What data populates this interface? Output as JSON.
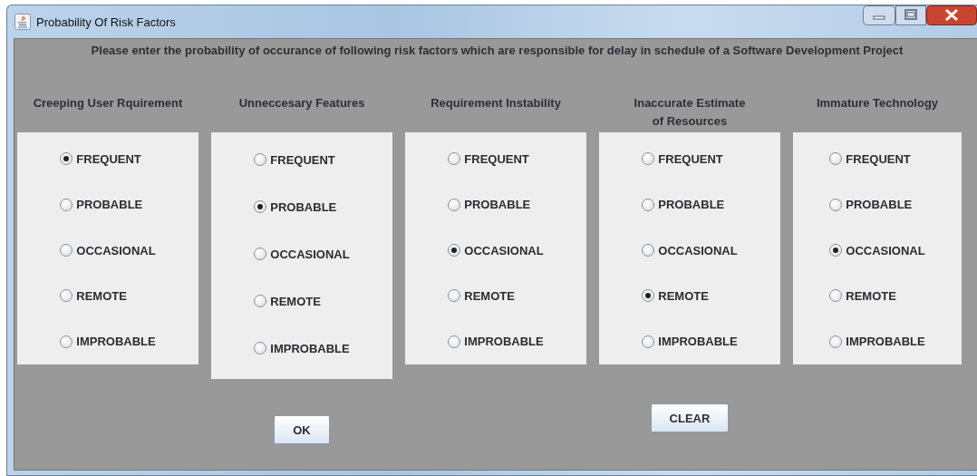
{
  "window": {
    "title": "Probability Of Risk Factors"
  },
  "instructions": "Please enter the probability of occurance of following risk factors which are responsible for delay in schedule of a Software Development Project",
  "risk_factors": [
    {
      "name": "Creeping User Rquirement",
      "options": [
        {
          "label": "FREQUENT",
          "selected": true
        },
        {
          "label": "PROBABLE",
          "selected": false
        },
        {
          "label": "OCCASIONAL",
          "selected": false
        },
        {
          "label": "REMOTE",
          "selected": false
        },
        {
          "label": "IMPROBABLE",
          "selected": false
        }
      ]
    },
    {
      "name": "Unneccesary Features",
      "options": [
        {
          "label": "FREQUENT",
          "selected": false
        },
        {
          "label": "PROBABLE",
          "selected": true
        },
        {
          "label": "OCCASIONAL",
          "selected": false
        },
        {
          "label": "REMOTE",
          "selected": false
        },
        {
          "label": "IMPROBABLE",
          "selected": false
        }
      ]
    },
    {
      "name": "Requirement Instability",
      "options": [
        {
          "label": "FREQUENT",
          "selected": false
        },
        {
          "label": "PROBABLE",
          "selected": false
        },
        {
          "label": "OCCASIONAL",
          "selected": true
        },
        {
          "label": "REMOTE",
          "selected": false
        },
        {
          "label": "IMPROBABLE",
          "selected": false
        }
      ]
    },
    {
      "name": "Inaccurate Estimate of Resources",
      "options": [
        {
          "label": "FREQUENT",
          "selected": false
        },
        {
          "label": "PROBABLE",
          "selected": false
        },
        {
          "label": "OCCASIONAL",
          "selected": false
        },
        {
          "label": "REMOTE",
          "selected": true
        },
        {
          "label": "IMPROBABLE",
          "selected": false
        }
      ]
    },
    {
      "name": "Immature Technology",
      "options": [
        {
          "label": "FREQUENT",
          "selected": false
        },
        {
          "label": "PROBABLE",
          "selected": false
        },
        {
          "label": "OCCASIONAL",
          "selected": true
        },
        {
          "label": "REMOTE",
          "selected": false
        },
        {
          "label": "IMPROBABLE",
          "selected": false
        }
      ]
    }
  ],
  "buttons": [
    {
      "label": "OK"
    },
    {
      "label": "CLEAR"
    }
  ]
}
